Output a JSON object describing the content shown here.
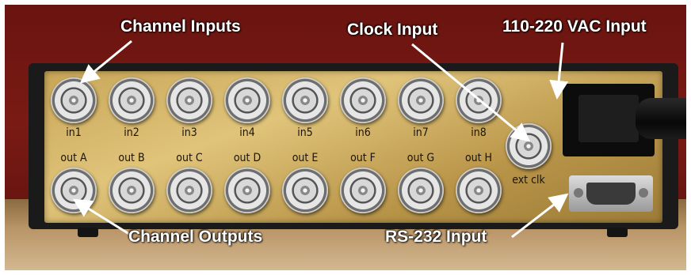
{
  "captions": {
    "channel_inputs": "Channel Inputs",
    "clock_input": "Clock Input",
    "power_input": "110-220 VAC Input",
    "channel_outputs": "Channel Outputs",
    "rs232_input": "RS-232 Input"
  },
  "panel_labels": {
    "inputs": [
      "in1",
      "in2",
      "in3",
      "in4",
      "in5",
      "in6",
      "in7",
      "in8"
    ],
    "outputs": [
      "out A",
      "out B",
      "out C",
      "out D",
      "out E",
      "out F",
      "out G",
      "out H"
    ],
    "clock": "ext clk"
  },
  "colors": {
    "background_wall": "#6a1410",
    "panel_brass": "#d0b060",
    "caption_text": "#ffffff"
  }
}
